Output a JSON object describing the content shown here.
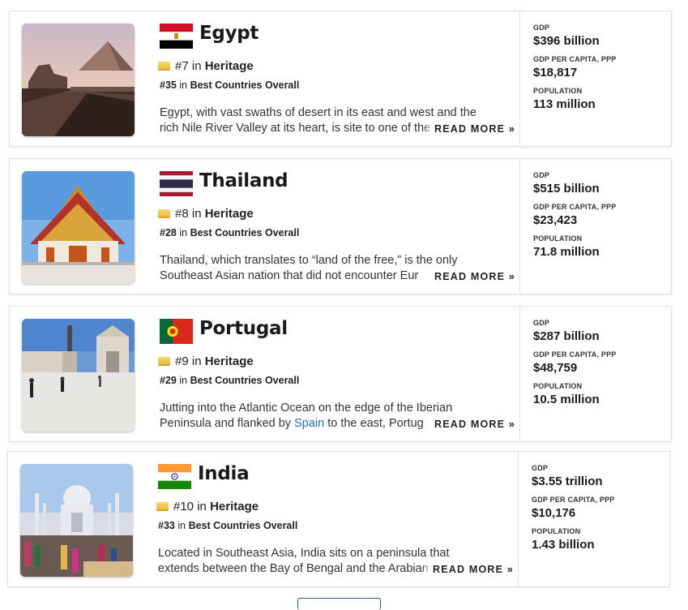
{
  "labels": {
    "in": "in",
    "read_more": "READ MORE »",
    "gdp": "GDP",
    "gdp_per_capita": "GDP PER CAPITA, PPP",
    "population": "POPULATION"
  },
  "countries": [
    {
      "name": "Egypt",
      "flag_icon": "egypt-flag-icon",
      "heritage_rank": "#7",
      "heritage_label": "Heritage",
      "overall_rank": "#35",
      "overall_label": "Best Countries Overall",
      "description": "Egypt, with vast swaths of desert in its east and west and the rich Nile River Valley at its heart, is site to one of the",
      "gdp": "$396 billion",
      "gdp_per_capita": "$18,817",
      "population": "113 million"
    },
    {
      "name": "Thailand",
      "flag_icon": "thailand-flag-icon",
      "heritage_rank": "#8",
      "heritage_label": "Heritage",
      "overall_rank": "#28",
      "overall_label": "Best Countries Overall",
      "description": "Thailand, which translates to “land of the free,” is the only Southeast Asian nation that did not encounter Eur",
      "gdp": "$515 billion",
      "gdp_per_capita": "$23,423",
      "population": "71.8 million"
    },
    {
      "name": "Portugal",
      "flag_icon": "portugal-flag-icon",
      "heritage_rank": "#9",
      "heritage_label": "Heritage",
      "overall_rank": "#29",
      "overall_label": "Best Countries Overall",
      "description_before_link": "Jutting into the Atlantic Ocean on the edge of the Iberian Peninsula and flanked by ",
      "description_link": "Spain",
      "description_after_link": " to the east, Portug",
      "gdp": "$287 billion",
      "gdp_per_capita": "$48,759",
      "population": "10.5 million"
    },
    {
      "name": "India",
      "flag_icon": "india-flag-icon",
      "heritage_rank": "#10",
      "heritage_label": "Heritage",
      "overall_rank": "#33",
      "overall_label": "Best Countries Overall",
      "description": "Located in Southeast Asia, India sits on a peninsula that extends between the Bay of Bengal and the Arabian Sea. T",
      "gdp": "$3.55 trillion",
      "gdp_per_capita": "$10,176",
      "population": "1.43 billion"
    }
  ]
}
